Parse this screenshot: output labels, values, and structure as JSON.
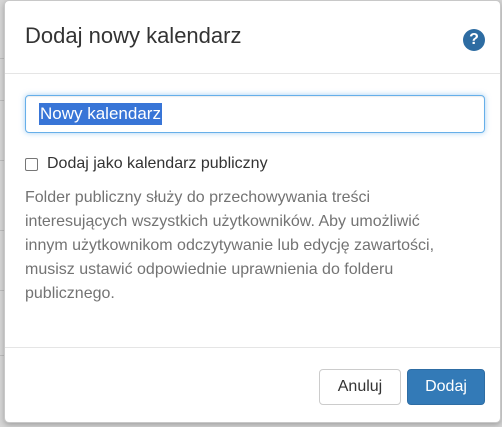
{
  "dialog": {
    "title": "Dodaj nowy kalendarz",
    "help_icon": "question-circle-icon",
    "help_glyph": "?"
  },
  "form": {
    "name_value": "Nowy kalendarz",
    "name_selected": true,
    "public_checkbox": {
      "label": "Dodaj jako kalendarz publiczny",
      "checked": false
    },
    "info_lines": [
      "Folder publiczny służy do przechowywania treści",
      "interesujących wszystkich użytkowników. Aby umożliwić",
      "innym użytkownikom odczytywanie lub edycję zawartości,",
      "musisz ustawić odpowiednie uprawnienia do folderu",
      "publicznego."
    ]
  },
  "footer": {
    "cancel_label": "Anuluj",
    "submit_label": "Dodaj"
  },
  "colors": {
    "primary": "#337ab7",
    "help": "#2d6ca2",
    "selection": "#3875d7",
    "focus_border": "#66afe9"
  }
}
